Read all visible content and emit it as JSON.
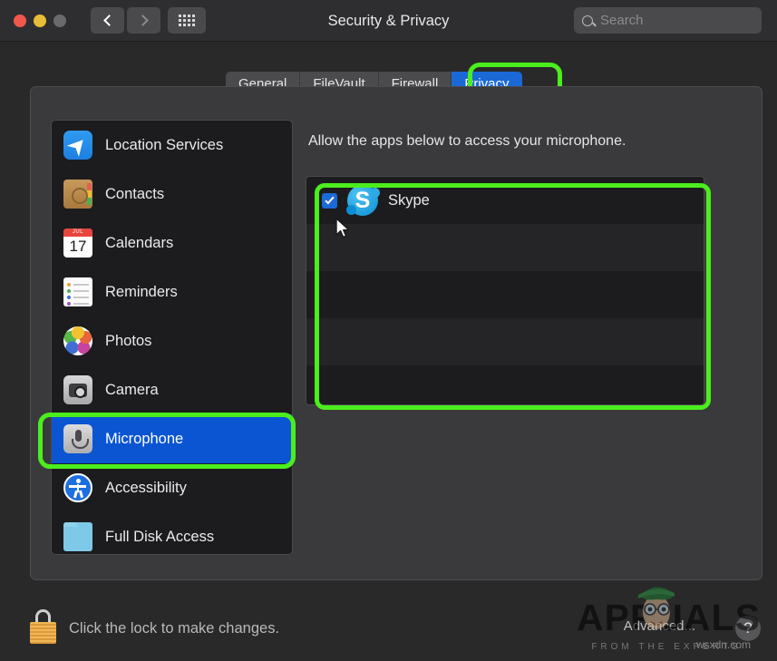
{
  "window": {
    "title": "Security & Privacy",
    "traffic_lights": [
      {
        "name": "close",
        "color": "#f2574b"
      },
      {
        "name": "minimize",
        "color": "#e8bd35"
      },
      {
        "name": "zoom",
        "color": "#6a6a6c"
      }
    ],
    "nav": {
      "back": "‹",
      "forward": "›"
    },
    "grid_button": "show-all-preferences"
  },
  "search": {
    "placeholder": "Search",
    "value": ""
  },
  "tabs": [
    {
      "label": "General",
      "active": false
    },
    {
      "label": "FileVault",
      "active": false
    },
    {
      "label": "Firewall",
      "active": false
    },
    {
      "label": "Privacy",
      "active": true
    }
  ],
  "sidebar": {
    "items": [
      {
        "label": "Location Services",
        "icon": "location-services-icon",
        "selected": false
      },
      {
        "label": "Contacts",
        "icon": "contacts-icon",
        "selected": false
      },
      {
        "label": "Calendars",
        "icon": "calendars-icon",
        "selected": false
      },
      {
        "label": "Reminders",
        "icon": "reminders-icon",
        "selected": false
      },
      {
        "label": "Photos",
        "icon": "photos-icon",
        "selected": false
      },
      {
        "label": "Camera",
        "icon": "camera-icon",
        "selected": false
      },
      {
        "label": "Microphone",
        "icon": "microphone-icon",
        "selected": true
      },
      {
        "label": "Accessibility",
        "icon": "accessibility-icon",
        "selected": false
      },
      {
        "label": "Full Disk Access",
        "icon": "folder-icon",
        "selected": false
      }
    ]
  },
  "calendar_icon": {
    "month": "JUL",
    "day": "17"
  },
  "main": {
    "description": "Allow the apps below to access your microphone.",
    "apps": [
      {
        "name": "Skype",
        "checked": true,
        "icon": "skype-icon"
      }
    ]
  },
  "footer": {
    "lock_text": "Click the lock to make changes.",
    "advanced_label": "Advanced...",
    "help_label": "?"
  },
  "watermark": {
    "main": "APPUALS",
    "sub": "FROM THE EXPERTS",
    "site": "wsxdn.com"
  },
  "colors": {
    "accent_blue": "#1b69d6",
    "selected_blue": "#0b55d3",
    "highlight_green": "#4bee1c",
    "window_bg": "#292929",
    "panel_bg": "#3a3a3c",
    "list_bg": "#1c1c1e",
    "list_alt_bg": "#252527"
  }
}
